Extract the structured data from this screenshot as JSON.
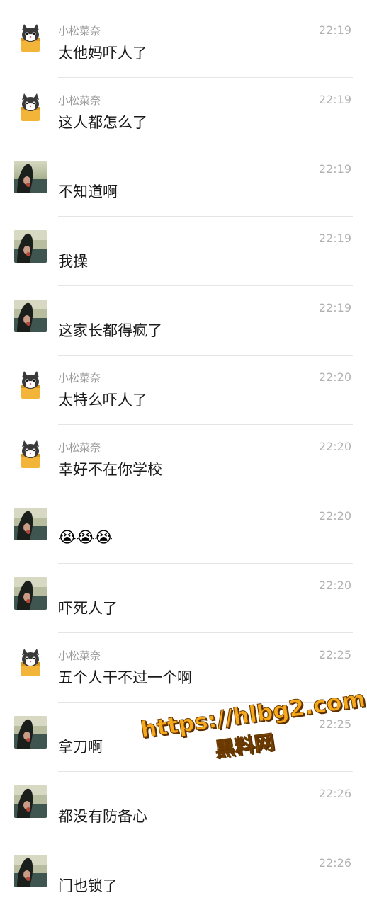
{
  "messages": [
    {
      "sender": "小松菜奈",
      "time": "22:19",
      "text": "太他妈吓人了",
      "avatar": "cat-avatar"
    },
    {
      "sender": "小松菜奈",
      "time": "22:19",
      "text": "这人都怎么了",
      "avatar": "cat-avatar"
    },
    {
      "sender": "",
      "time": "22:19",
      "text": "不知道啊",
      "avatar": "girl-sunset-avatar"
    },
    {
      "sender": "",
      "time": "22:19",
      "text": "我操",
      "avatar": "girl-sunset-avatar"
    },
    {
      "sender": "",
      "time": "22:19",
      "text": "这家长都得疯了",
      "avatar": "girl-sunset-avatar"
    },
    {
      "sender": "小松菜奈",
      "time": "22:20",
      "text": "太特么吓人了",
      "avatar": "cat-avatar"
    },
    {
      "sender": "小松菜奈",
      "time": "22:20",
      "text": "幸好不在你学校",
      "avatar": "cat-avatar"
    },
    {
      "sender": "",
      "time": "22:20",
      "text": "😭😭😭",
      "avatar": "girl-sunset-avatar"
    },
    {
      "sender": "",
      "time": "22:20",
      "text": "吓死人了",
      "avatar": "girl-sunset-avatar"
    },
    {
      "sender": "小松菜奈",
      "time": "22:25",
      "text": "五个人干不过一个啊",
      "avatar": "cat-avatar"
    },
    {
      "sender": "",
      "time": "22:25",
      "text": "拿刀啊",
      "avatar": "girl-sunset-avatar"
    },
    {
      "sender": "",
      "time": "22:26",
      "text": "都没有防备心",
      "avatar": "girl-sunset-avatar"
    },
    {
      "sender": "",
      "time": "22:26",
      "text": "门也锁了",
      "avatar": "girl-sunset-avatar"
    }
  ],
  "watermark": {
    "url": "https://hlbg2.com",
    "name": "黑料网"
  }
}
